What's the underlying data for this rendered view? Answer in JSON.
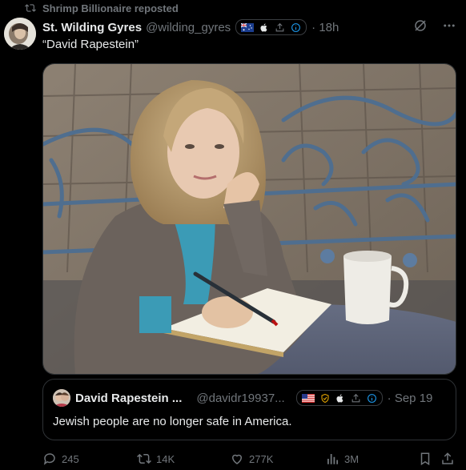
{
  "repost": {
    "text": "Shrimp Billionaire reposted",
    "icon": "repost-icon"
  },
  "tweet": {
    "name": "St. Wilding Gyres",
    "handle": "@wilding_gyres",
    "time": "· 18h",
    "text": "“David Rapestein”",
    "badges": [
      "au-flag-icon",
      "apple-icon",
      "share-icon",
      "info-icon"
    ],
    "menu_icons": [
      "grok-icon",
      "more-icon"
    ]
  },
  "quote": {
    "name": "David Rapestein ...",
    "handle": "@davidr19937...",
    "time": "· Sep 19",
    "text": "Jewish people are no longer safe in America.",
    "badges": [
      "us-flag-icon",
      "shield-icon",
      "apple-icon",
      "share-icon",
      "info-icon"
    ]
  },
  "actions": {
    "replies": "245",
    "reposts": "14K",
    "likes": "277K",
    "views": "3M"
  },
  "colors": {
    "background": "#000000",
    "text": "#e7e9ea",
    "muted": "#71767b",
    "border": "#2f3336",
    "accent": "#1d9bf0"
  }
}
